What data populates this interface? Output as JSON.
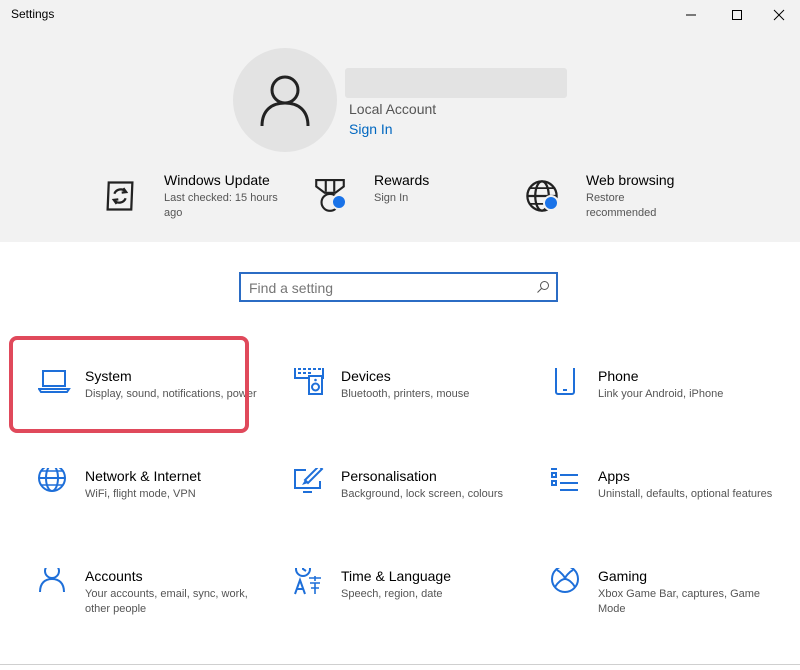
{
  "window": {
    "title": "Settings"
  },
  "profile": {
    "account_type": "Local Account",
    "sign_in": "Sign In"
  },
  "quick_links": [
    {
      "title": "Windows Update",
      "subtitle": "Last checked: 15 hours ago",
      "icon": "refresh-icon"
    },
    {
      "title": "Rewards",
      "subtitle": "Sign In",
      "icon": "medal-icon"
    },
    {
      "title": "Web browsing",
      "subtitle": "Restore recommended",
      "icon": "globe-icon"
    }
  ],
  "search": {
    "placeholder": "Find a setting"
  },
  "tiles": [
    {
      "name": "System",
      "desc": "Display, sound, notifications, power",
      "icon": "laptop-icon"
    },
    {
      "name": "Devices",
      "desc": "Bluetooth, printers, mouse",
      "icon": "keyboard-speaker-icon"
    },
    {
      "name": "Phone",
      "desc": "Link your Android, iPhone",
      "icon": "phone-icon"
    },
    {
      "name": "Network & Internet",
      "desc": "WiFi, flight mode, VPN",
      "icon": "globe-icon"
    },
    {
      "name": "Personalisation",
      "desc": "Background, lock screen, colours",
      "icon": "paint-brush-icon"
    },
    {
      "name": "Apps",
      "desc": "Uninstall, defaults, optional features",
      "icon": "app-list-icon"
    },
    {
      "name": "Accounts",
      "desc": "Your accounts, email, sync, work, other people",
      "icon": "person-icon"
    },
    {
      "name": "Time & Language",
      "desc": "Speech, region, date",
      "icon": "language-icon"
    },
    {
      "name": "Gaming",
      "desc": "Xbox Game Bar, captures, Game Mode",
      "icon": "xbox-icon"
    }
  ],
  "colors": {
    "accent": "#0067c0",
    "icon_blue": "#1e6fd9",
    "highlight": "#e0495b",
    "header_bg": "#f2f2f2"
  }
}
